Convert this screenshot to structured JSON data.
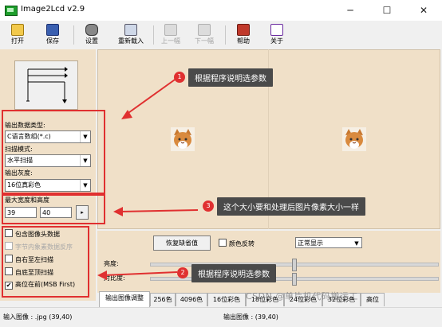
{
  "window": {
    "title": "Image2Lcd v2.9",
    "controls": {
      "minimize": "─",
      "maximize": "☐",
      "close": "✕"
    }
  },
  "toolbar": {
    "items": [
      {
        "label": "打开",
        "icon": "open-folder-icon",
        "enabled": true
      },
      {
        "label": "保存",
        "icon": "save-icon",
        "enabled": true
      },
      {
        "label": "设置",
        "icon": "settings-icon",
        "enabled": true
      },
      {
        "label": "重新载入",
        "icon": "reload-icon",
        "enabled": true
      },
      {
        "label": "上一幅",
        "icon": "prev-image-icon",
        "enabled": false
      },
      {
        "label": "下一幅",
        "icon": "next-image-icon",
        "enabled": false
      },
      {
        "label": "帮助",
        "icon": "help-book-icon",
        "enabled": true
      },
      {
        "label": "关于",
        "icon": "about-i2l-icon",
        "enabled": true
      }
    ]
  },
  "left_panel": {
    "output_type_label": "输出数据类型:",
    "output_type_value": "C语言数组(*.c)",
    "scan_mode_label": "扫描模式:",
    "scan_mode_value": "水平扫描",
    "output_gray_label": "输出灰度:",
    "output_gray_value": "16位真彩色",
    "max_size_label": "最大宽度和高度",
    "max_width": "39",
    "max_height": "40",
    "apply_button": "▸",
    "options": [
      {
        "label": "包含图像头数据",
        "checked": false,
        "enabled": true
      },
      {
        "label": "字节内象素数据反序",
        "checked": false,
        "enabled": false
      },
      {
        "label": "自右至左扫描",
        "checked": false,
        "enabled": true
      },
      {
        "label": "自底至顶扫描",
        "checked": false,
        "enabled": true
      },
      {
        "label": "高位在前(MSB First)",
        "checked": true,
        "enabled": true
      }
    ]
  },
  "controls": {
    "restore_default_button": "恢复缺省值",
    "invert_color_label": "颜色反转",
    "invert_color_checked": false,
    "display_mode_value": "正常显示",
    "brightness_label": "亮度:",
    "contrast_label": "对比度:",
    "brightness_level": 0.5,
    "contrast_level": 0.5
  },
  "tabs": [
    "输出图像调整",
    "256色",
    "4096色",
    "16位彩色",
    "18位彩色",
    "24位彩色",
    "32位彩色",
    "高位"
  ],
  "status": {
    "input_image": "输入图像 : .jpg (39,40)",
    "output_image": "输出图像 : (39,40)"
  },
  "watermark": "CSDN @单片机代码搬运工",
  "annotations": [
    {
      "number": "1",
      "text": "根据程序说明选参数"
    },
    {
      "number": "2",
      "text": "根据程序说明选参数"
    },
    {
      "number": "3",
      "text": "这个大小要和处理后图片像素大小一样"
    }
  ],
  "colors": {
    "panel_bg": "#f0e0c8",
    "annotation_red": "#e03030",
    "callout_bg": "#4a4a4a"
  }
}
